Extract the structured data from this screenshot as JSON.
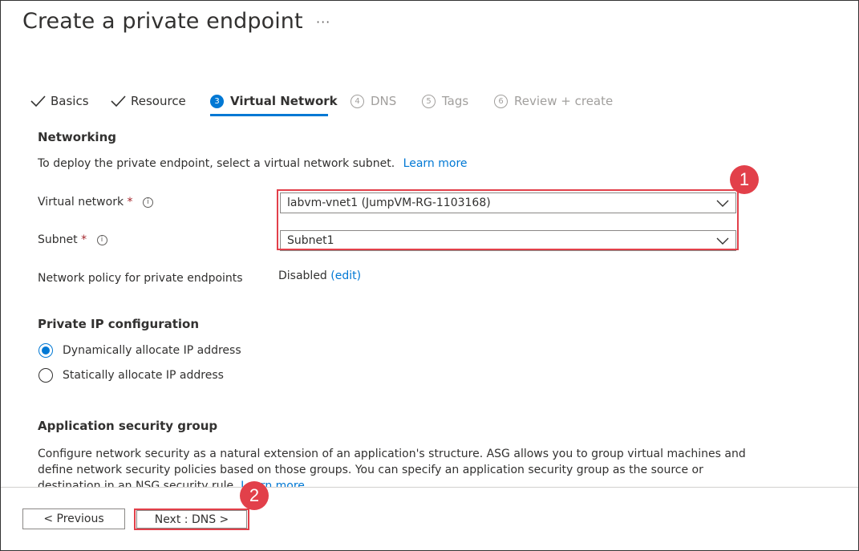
{
  "page": {
    "title": "Create a private endpoint",
    "more": "···"
  },
  "tabs": [
    {
      "label": "Basics",
      "state": "done"
    },
    {
      "label": "Resource",
      "state": "done"
    },
    {
      "num": "3",
      "label": "Virtual Network",
      "state": "active"
    },
    {
      "num": "4",
      "label": "DNS",
      "state": "disabled"
    },
    {
      "num": "5",
      "label": "Tags",
      "state": "disabled"
    },
    {
      "num": "6",
      "label": "Review + create",
      "state": "disabled"
    }
  ],
  "networking": {
    "heading": "Networking",
    "description": "To deploy the private endpoint, select a virtual network subnet.",
    "learn_more": "Learn more",
    "vnet_label": "Virtual network",
    "vnet_value": "labvm-vnet1 (JumpVM-RG-1103168)",
    "subnet_label": "Subnet",
    "subnet_value": "Subnet1",
    "required_mark": "*",
    "info_glyph": "i",
    "policy_label": "Network policy for private endpoints",
    "policy_value": "Disabled",
    "policy_edit": "(edit)"
  },
  "private_ip": {
    "heading": "Private IP configuration",
    "options": [
      "Dynamically allocate IP address",
      "Statically allocate IP address"
    ],
    "selected": 0
  },
  "asg": {
    "heading": "Application security group",
    "text": "Configure network security as a natural extension of an application's structure. ASG allows you to group virtual machines and define network security policies based on those groups. You can specify an application security group as the source or destination in an NSG security rule.",
    "learn_more": "Learn more"
  },
  "footer": {
    "previous": "< Previous",
    "next": "Next : DNS >"
  },
  "annotations": {
    "badge1": "1",
    "badge2": "2",
    "color": "#e2404a"
  },
  "colors": {
    "accent": "#0078d4",
    "text": "#323130",
    "disabled": "#a19f9d"
  }
}
